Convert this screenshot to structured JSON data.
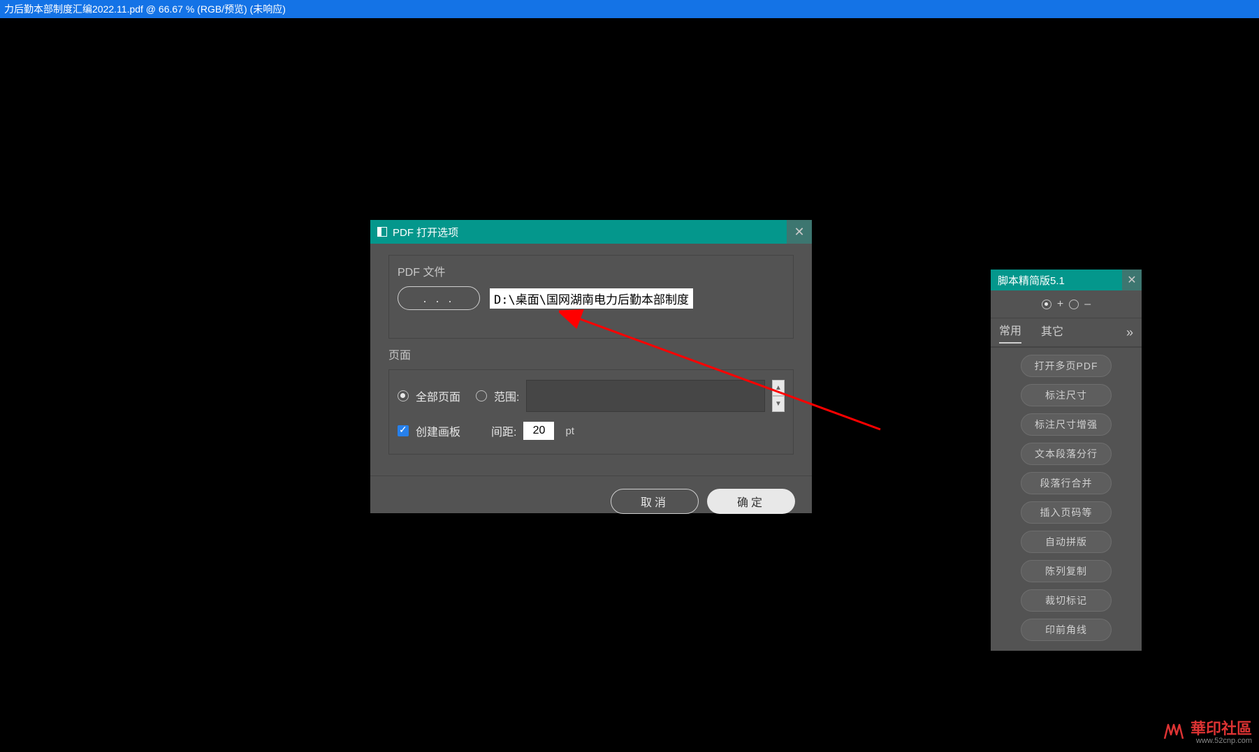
{
  "titlebar": "力后勤本部制度汇编2022.11.pdf @ 66.67 % (RGB/预览)  (未响应)",
  "dialog": {
    "title": "PDF 打开选项",
    "file_section_label": "PDF 文件",
    "browse_button": ". . .",
    "file_path": "D:\\桌面\\国网湖南电力后勤本部制度",
    "page_section_label": "页面",
    "all_pages_label": "全部页面",
    "range_label": "范围:",
    "range_value": "",
    "create_artboard_label": "创建画板",
    "spacing_label": "间距:",
    "spacing_value": "20",
    "spacing_unit": "pt",
    "cancel_button": "取消",
    "ok_button": "确定"
  },
  "panel": {
    "title": "脚本精简版5.1",
    "mode_plus": "+",
    "mode_minus": "–",
    "tab_common": "常用",
    "tab_other": "其它",
    "more": "»",
    "items": [
      "打开多页PDF",
      "标注尺寸",
      "标注尺寸增强",
      "文本段落分行",
      "段落行合并",
      "插入页码等",
      "自动拼版",
      "陈列复制",
      "裁切标记",
      "印前角线"
    ]
  },
  "watermark": {
    "main": "華印社區",
    "sub": "www.52cnp.com"
  }
}
